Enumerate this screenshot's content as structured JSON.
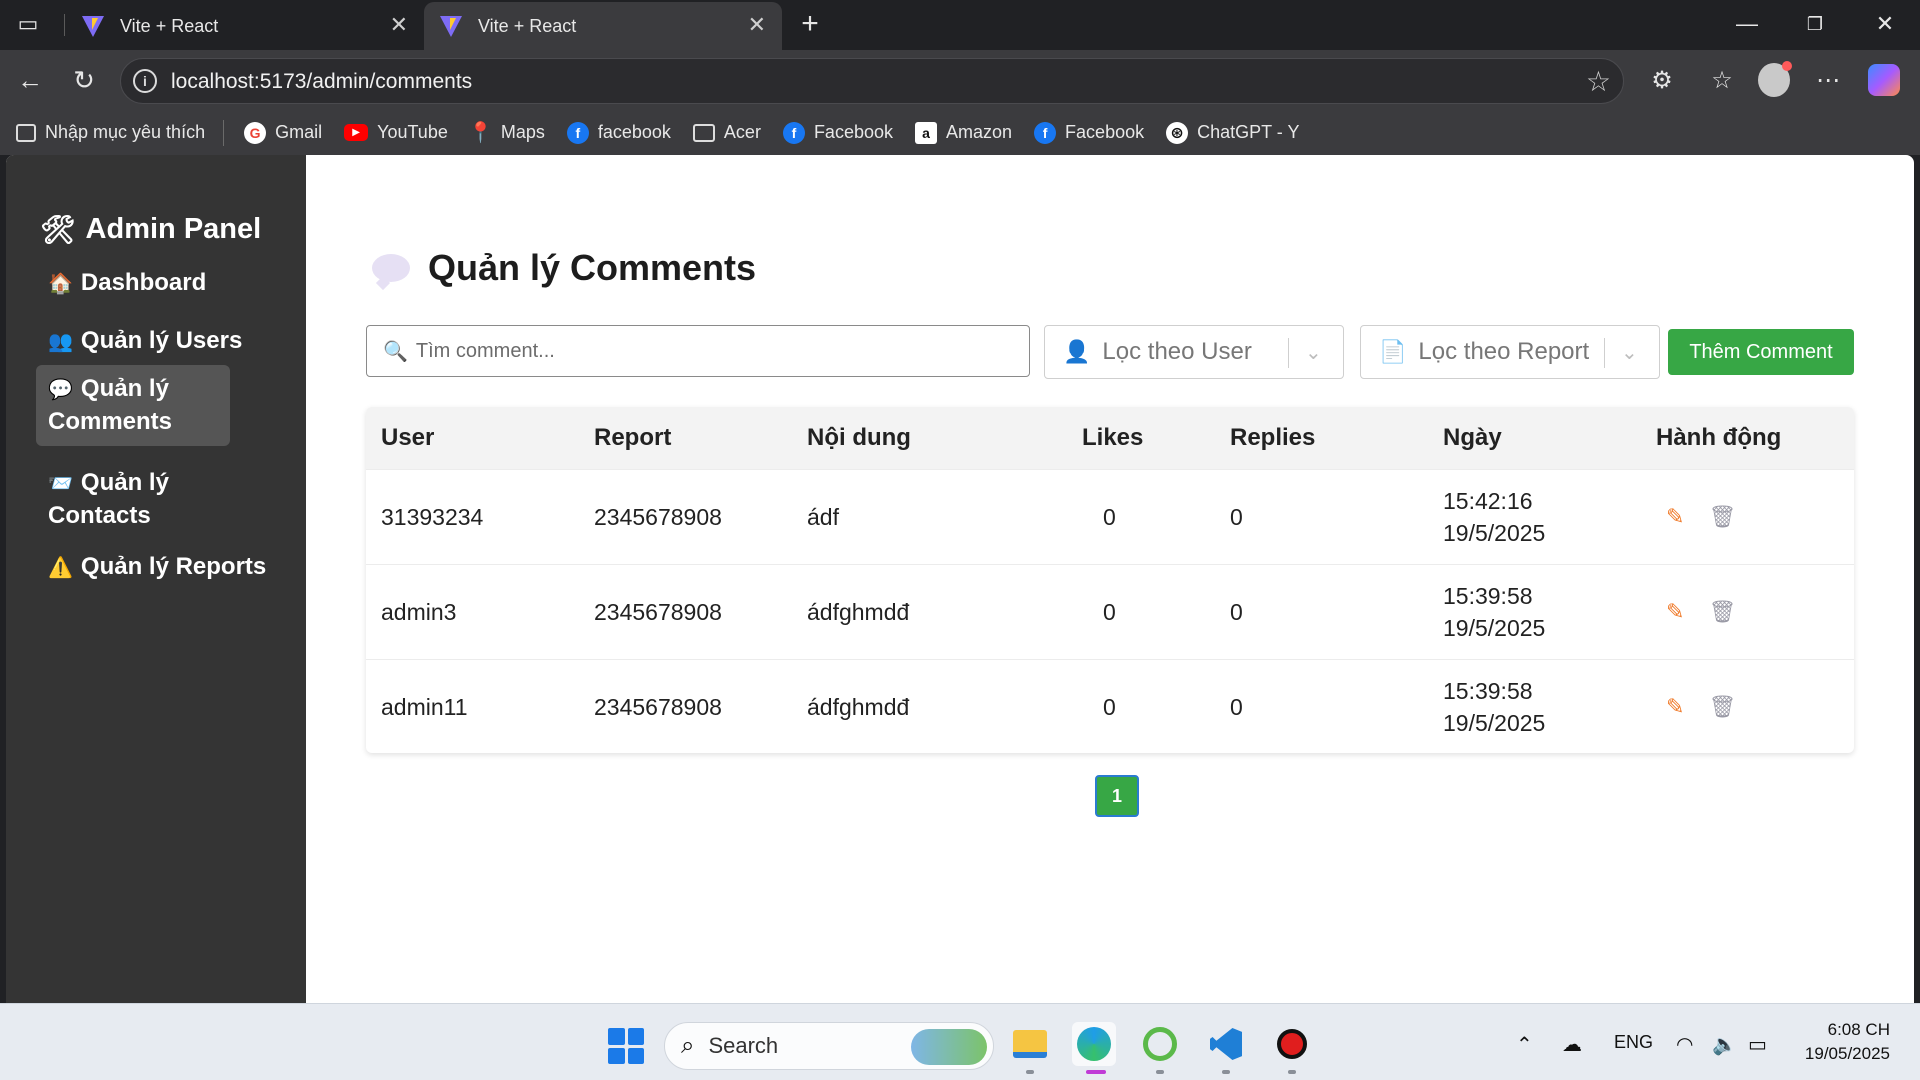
{
  "browser": {
    "tabs": [
      {
        "title": "Vite + React",
        "active": false
      },
      {
        "title": "Vite + React",
        "active": true
      }
    ],
    "new_tab_icon": "plus-icon",
    "url": "localhost:5173/admin/comments",
    "bookmarks": [
      {
        "label": "Nhập mục yêu thích",
        "icon": "import-favorites-icon"
      },
      {
        "label": "Gmail",
        "icon": "google-icon",
        "color": "#ea4335",
        "glyph": "G"
      },
      {
        "label": "YouTube",
        "icon": "youtube-icon",
        "color": "#ff0000",
        "glyph": "▶"
      },
      {
        "label": "Maps",
        "icon": "maps-icon",
        "color": "#34a853",
        "glyph": "●"
      },
      {
        "label": "facebook",
        "icon": "facebook-icon",
        "color": "#1877f2",
        "glyph": "f"
      },
      {
        "label": "Acer",
        "icon": "folder-icon",
        "color": "transparent",
        "glyph": "🗀"
      },
      {
        "label": "Facebook",
        "icon": "facebook-icon",
        "color": "#1877f2",
        "glyph": "f"
      },
      {
        "label": "Amazon",
        "icon": "amazon-icon",
        "color": "#ffffff",
        "glyph": "a"
      },
      {
        "label": "Facebook",
        "icon": "facebook-icon",
        "color": "#1877f2",
        "glyph": "f"
      },
      {
        "label": "ChatGPT - Y",
        "icon": "chatgpt-icon",
        "color": "#ffffff",
        "glyph": "⊛"
      }
    ]
  },
  "sidebar": {
    "title": "Admin Panel",
    "items": [
      {
        "label": "Dashboard",
        "emoji": "🏠",
        "active": false
      },
      {
        "label": "Quản lý Users",
        "emoji": "👥",
        "active": false
      },
      {
        "label": "Quản lý Comments",
        "emoji": "💬",
        "active": true
      },
      {
        "label": "Quản lý Contacts",
        "emoji": "📨",
        "active": false
      },
      {
        "label": "Quản lý Reports",
        "emoji": "⚠️",
        "active": false
      }
    ]
  },
  "main": {
    "title": "Quản lý Comments",
    "search_placeholder": "Tìm comment...",
    "filter_user": "Lọc theo User",
    "filter_report": "Lọc theo Report",
    "add_button": "Thêm Comment",
    "columns": [
      "User",
      "Report",
      "Nội dung",
      "Likes",
      "Replies",
      "Ngày",
      "Hành động"
    ],
    "rows": [
      {
        "user": "31393234",
        "report": "2345678908",
        "content": "ádf",
        "likes": "0",
        "replies": "0",
        "time": "15:42:16",
        "date": "19/5/2025"
      },
      {
        "user": "admin3",
        "report": "2345678908",
        "content": "ádfghmdđ",
        "likes": "0",
        "replies": "0",
        "time": "15:39:58",
        "date": "19/5/2025"
      },
      {
        "user": "admin11",
        "report": "2345678908",
        "content": "ádfghmdđ",
        "likes": "0",
        "replies": "0",
        "time": "15:39:58",
        "date": "19/5/2025"
      }
    ],
    "current_page": "1",
    "colors": {
      "accent_green": "#37a745",
      "edit_icon": "#f07a2a",
      "sidebar_bg": "#343434"
    }
  },
  "taskbar": {
    "search_label": "Search",
    "language": "ENG",
    "time": "6:08 CH",
    "date": "19/05/2025"
  }
}
